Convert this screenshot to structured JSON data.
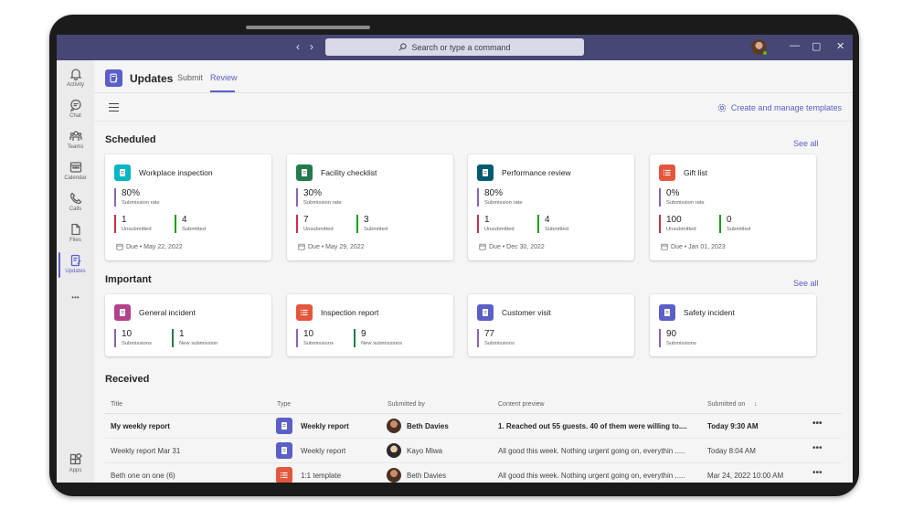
{
  "titlebar": {
    "search_placeholder": "Search or type a command",
    "back": "‹",
    "forward": "›",
    "minimize": "—",
    "maximize": "▢",
    "close": "✕"
  },
  "rail": [
    {
      "label": "Activity",
      "icon": "bell-icon"
    },
    {
      "label": "Chat",
      "icon": "chat-icon"
    },
    {
      "label": "Teams",
      "icon": "teams-icon"
    },
    {
      "label": "Calendar",
      "icon": "calendar-icon"
    },
    {
      "label": "Calls",
      "icon": "phone-icon"
    },
    {
      "label": "Files",
      "icon": "file-icon"
    },
    {
      "label": "Updates",
      "icon": "updates-icon",
      "active": true
    },
    {
      "label": "Apps",
      "icon": "apps-icon"
    }
  ],
  "rail_more": "•••",
  "app": {
    "title": "Updates",
    "tabs": [
      {
        "label": "Submit"
      },
      {
        "label": "Review",
        "active": true
      }
    ],
    "manage_label": "Create and manage templates"
  },
  "scheduled": {
    "title": "Scheduled",
    "see_all": "See all",
    "cards": [
      {
        "title": "Workplace inspection",
        "icon_color": "#00b7c3",
        "rate": "80%",
        "rate_label": "Submission rate",
        "unsubmitted": "1",
        "unsubmitted_label": "Unsubmitted",
        "submitted": "4",
        "submitted_label": "Submitted",
        "due": "Due • May 22, 2022"
      },
      {
        "title": "Facility checklist",
        "icon_color": "#237b4b",
        "rate": "30%",
        "rate_label": "Submission rate",
        "unsubmitted": "7",
        "unsubmitted_label": "Unsubmitted",
        "submitted": "3",
        "submitted_label": "Submitted",
        "due": "Due • May 29, 2022"
      },
      {
        "title": "Performance review",
        "icon_color": "#005b70",
        "rate": "80%",
        "rate_label": "Submission rate",
        "unsubmitted": "1",
        "unsubmitted_label": "Unsubmitted",
        "submitted": "4",
        "submitted_label": "Submitted",
        "due": "Due • Dec 30, 2022"
      },
      {
        "title": "Gift list",
        "icon_color": "#e3573c",
        "rate": "0%",
        "rate_label": "Submission rate",
        "unsubmitted": "100",
        "unsubmitted_label": "Unsubmitted",
        "submitted": "0",
        "submitted_label": "Submitted",
        "due": "Due • Jan 01, 2023"
      }
    ]
  },
  "important": {
    "title": "Important",
    "see_all": "See all",
    "cards": [
      {
        "title": "General incident",
        "icon_color": "#b4418b",
        "count": "10",
        "count_label": "Submissions",
        "new": "1",
        "new_label": "New submission"
      },
      {
        "title": "Inspection report",
        "icon_color": "#e3573c",
        "count": "10",
        "count_label": "Submissions",
        "new": "9",
        "new_label": "New submissions"
      },
      {
        "title": "Customer visit",
        "icon_color": "#5b5fc7",
        "count": "77",
        "count_label": "Submissions"
      },
      {
        "title": "Safety incident",
        "icon_color": "#5b5fc7",
        "count": "90",
        "count_label": "Submissions"
      }
    ]
  },
  "received": {
    "title": "Received",
    "columns": {
      "title": "Title",
      "type": "Type",
      "submitted_by": "Submitted by",
      "preview": "Content preview",
      "submitted_on": "Submitted on",
      "sort": "↓"
    },
    "rows": [
      {
        "title": "My weekly report",
        "type": "Weekly report",
        "type_color": "#5b5fc7",
        "person": "Beth Davies",
        "preview": "1. Reached out 55 guests. 40 of them were willing to....",
        "date": "Today 9:30 AM",
        "bold": true
      },
      {
        "title": "Weekly report Mar 31",
        "type": "Weekly report",
        "type_color": "#5b5fc7",
        "person": "Kayo Miwa",
        "preview": "All good this week. Nothing urgent going on, everythin .....",
        "date": "Today 8:04 AM",
        "bold": false
      },
      {
        "title": "Beth one on one (6)",
        "type": "1:1 template",
        "type_color": "#e3573c",
        "person": "Beth Davies",
        "preview": "All good this week. Nothing urgent going on, everythin .....",
        "date": "Mar 24, 2022 10:00 AM",
        "bold": false
      }
    ],
    "more": "•••"
  }
}
